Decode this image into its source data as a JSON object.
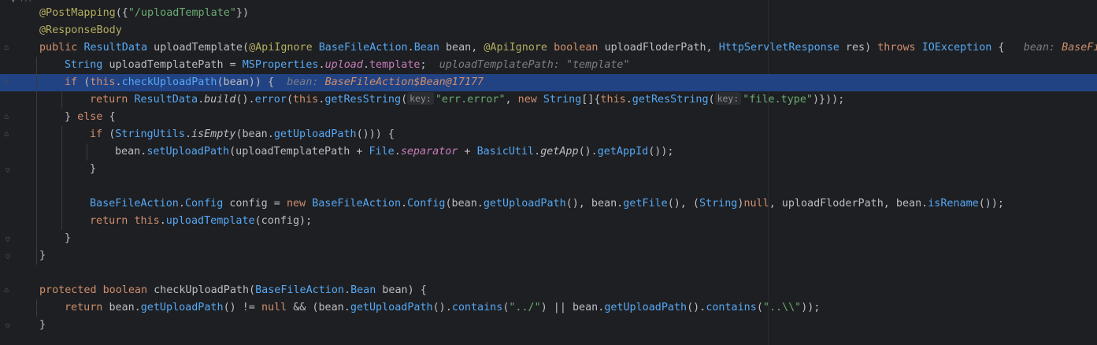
{
  "editor": {
    "lines": [
      {
        "indent": 1,
        "segments": [
          {
            "cls": "ann",
            "text": "@PostMapping"
          },
          {
            "cls": "plain",
            "text": "({"
          },
          {
            "cls": "str",
            "text": "\"/uploadTemplate\""
          },
          {
            "cls": "plain",
            "text": "})"
          }
        ]
      },
      {
        "indent": 1,
        "segments": [
          {
            "cls": "ann",
            "text": "@ResponseBody"
          }
        ]
      },
      {
        "indent": 1,
        "segments": [
          {
            "cls": "kw",
            "text": "public "
          },
          {
            "cls": "type",
            "text": "ResultData "
          },
          {
            "cls": "plain",
            "text": "uploadTemplate("
          },
          {
            "cls": "ann",
            "text": "@ApiIgnore "
          },
          {
            "cls": "type",
            "text": "BaseFileAction"
          },
          {
            "cls": "plain",
            "text": "."
          },
          {
            "cls": "type",
            "text": "Bean"
          },
          {
            "cls": "plain",
            "text": " bean, "
          },
          {
            "cls": "ann",
            "text": "@ApiIgnore "
          },
          {
            "cls": "kw",
            "text": "boolean "
          },
          {
            "cls": "plain",
            "text": "uploadFloderPath, "
          },
          {
            "cls": "type",
            "text": "HttpServletResponse"
          },
          {
            "cls": "plain",
            "text": " res) "
          },
          {
            "cls": "kw",
            "text": "throws "
          },
          {
            "cls": "type",
            "text": "IOException"
          },
          {
            "cls": "plain",
            "text": " {   "
          },
          {
            "cls": "hint",
            "text": "bean: "
          },
          {
            "cls": "hint-val",
            "text": "BaseFile"
          }
        ]
      },
      {
        "indent": 2,
        "segments": [
          {
            "cls": "type",
            "text": "String "
          },
          {
            "cls": "plain",
            "text": "uploadTemplatePath = "
          },
          {
            "cls": "type",
            "text": "MSProperties"
          },
          {
            "cls": "plain",
            "text": "."
          },
          {
            "cls": "sfield",
            "text": "upload"
          },
          {
            "cls": "plain",
            "text": "."
          },
          {
            "cls": "field",
            "text": "template"
          },
          {
            "cls": "plain",
            "text": ";  "
          },
          {
            "cls": "hint",
            "text": "uploadTemplatePath: \"template\""
          }
        ]
      },
      {
        "indent": 2,
        "highlight": true,
        "segments": [
          {
            "cls": "kw",
            "text": "if "
          },
          {
            "cls": "plain",
            "text": "("
          },
          {
            "cls": "kw",
            "text": "this"
          },
          {
            "cls": "plain",
            "text": "."
          },
          {
            "cls": "mcall",
            "text": "checkUploadPath"
          },
          {
            "cls": "plain",
            "text": "(bean)) {  "
          },
          {
            "cls": "hint",
            "text": "bean: "
          },
          {
            "cls": "hint-val",
            "text": "BaseFileAction$Bean@17177"
          }
        ]
      },
      {
        "indent": 3,
        "segments": [
          {
            "cls": "kw",
            "text": "return "
          },
          {
            "cls": "type",
            "text": "ResultData"
          },
          {
            "cls": "plain",
            "text": "."
          },
          {
            "cls": "static-call",
            "text": "build"
          },
          {
            "cls": "plain",
            "text": "()."
          },
          {
            "cls": "mcall",
            "text": "error"
          },
          {
            "cls": "plain",
            "text": "("
          },
          {
            "cls": "kw",
            "text": "this"
          },
          {
            "cls": "plain",
            "text": "."
          },
          {
            "cls": "mcall",
            "text": "getResString"
          },
          {
            "cls": "plain",
            "text": "("
          },
          {
            "cls": "inlay",
            "text": "key:"
          },
          {
            "cls": "str",
            "text": "\"err.error\""
          },
          {
            "cls": "plain",
            "text": ", "
          },
          {
            "cls": "kw",
            "text": "new "
          },
          {
            "cls": "type",
            "text": "String"
          },
          {
            "cls": "plain",
            "text": "[]{"
          },
          {
            "cls": "kw",
            "text": "this"
          },
          {
            "cls": "plain",
            "text": "."
          },
          {
            "cls": "mcall",
            "text": "getResString"
          },
          {
            "cls": "plain",
            "text": "("
          },
          {
            "cls": "inlay",
            "text": "key:"
          },
          {
            "cls": "str",
            "text": "\"file.type\""
          },
          {
            "cls": "plain",
            "text": ")}));"
          }
        ]
      },
      {
        "indent": 2,
        "segments": [
          {
            "cls": "plain",
            "text": "} "
          },
          {
            "cls": "kw",
            "text": "else "
          },
          {
            "cls": "plain",
            "text": "{"
          }
        ]
      },
      {
        "indent": 3,
        "segments": [
          {
            "cls": "kw",
            "text": "if "
          },
          {
            "cls": "plain",
            "text": "("
          },
          {
            "cls": "type",
            "text": "StringUtils"
          },
          {
            "cls": "plain",
            "text": "."
          },
          {
            "cls": "static-call",
            "text": "isEmpty"
          },
          {
            "cls": "plain",
            "text": "(bean."
          },
          {
            "cls": "mcall",
            "text": "getUploadPath"
          },
          {
            "cls": "plain",
            "text": "())) {"
          }
        ]
      },
      {
        "indent": 4,
        "segments": [
          {
            "cls": "plain",
            "text": "bean."
          },
          {
            "cls": "mcall",
            "text": "setUploadPath"
          },
          {
            "cls": "plain",
            "text": "(uploadTemplatePath + "
          },
          {
            "cls": "type",
            "text": "File"
          },
          {
            "cls": "plain",
            "text": "."
          },
          {
            "cls": "sfield",
            "text": "separator"
          },
          {
            "cls": "plain",
            "text": " + "
          },
          {
            "cls": "type",
            "text": "BasicUtil"
          },
          {
            "cls": "plain",
            "text": "."
          },
          {
            "cls": "static-call",
            "text": "getApp"
          },
          {
            "cls": "plain",
            "text": "()."
          },
          {
            "cls": "mcall",
            "text": "getAppId"
          },
          {
            "cls": "plain",
            "text": "());"
          }
        ]
      },
      {
        "indent": 3,
        "segments": [
          {
            "cls": "plain",
            "text": "}"
          }
        ]
      },
      {
        "indent": 0,
        "segments": []
      },
      {
        "indent": 3,
        "segments": [
          {
            "cls": "type",
            "text": "BaseFileAction"
          },
          {
            "cls": "plain",
            "text": "."
          },
          {
            "cls": "type",
            "text": "Config"
          },
          {
            "cls": "plain",
            "text": " config = "
          },
          {
            "cls": "kw",
            "text": "new "
          },
          {
            "cls": "type",
            "text": "BaseFileAction"
          },
          {
            "cls": "plain",
            "text": "."
          },
          {
            "cls": "type",
            "text": "Config"
          },
          {
            "cls": "plain",
            "text": "(bean."
          },
          {
            "cls": "mcall",
            "text": "getUploadPath"
          },
          {
            "cls": "plain",
            "text": "(), bean."
          },
          {
            "cls": "mcall",
            "text": "getFile"
          },
          {
            "cls": "plain",
            "text": "(), ("
          },
          {
            "cls": "type",
            "text": "String"
          },
          {
            "cls": "plain",
            "text": ")"
          },
          {
            "cls": "kw",
            "text": "null"
          },
          {
            "cls": "plain",
            "text": ", uploadFloderPath, bean."
          },
          {
            "cls": "mcall",
            "text": "isRename"
          },
          {
            "cls": "plain",
            "text": "());"
          }
        ]
      },
      {
        "indent": 3,
        "segments": [
          {
            "cls": "kw",
            "text": "return "
          },
          {
            "cls": "kw",
            "text": "this"
          },
          {
            "cls": "plain",
            "text": "."
          },
          {
            "cls": "mcall",
            "text": "uploadTemplate"
          },
          {
            "cls": "plain",
            "text": "(config);"
          }
        ]
      },
      {
        "indent": 2,
        "segments": [
          {
            "cls": "plain",
            "text": "}"
          }
        ]
      },
      {
        "indent": 1,
        "segments": [
          {
            "cls": "plain",
            "text": "}"
          }
        ]
      },
      {
        "indent": 0,
        "segments": []
      },
      {
        "indent": 1,
        "segments": [
          {
            "cls": "kw",
            "text": "protected "
          },
          {
            "cls": "kw",
            "text": "boolean "
          },
          {
            "cls": "plain",
            "text": "checkUploadPath("
          },
          {
            "cls": "type",
            "text": "BaseFileAction"
          },
          {
            "cls": "plain",
            "text": "."
          },
          {
            "cls": "type",
            "text": "Bean"
          },
          {
            "cls": "plain",
            "text": " bean) {"
          }
        ]
      },
      {
        "indent": 2,
        "segments": [
          {
            "cls": "kw",
            "text": "return "
          },
          {
            "cls": "plain",
            "text": "bean."
          },
          {
            "cls": "mcall",
            "text": "getUploadPath"
          },
          {
            "cls": "plain",
            "text": "() != "
          },
          {
            "cls": "kw",
            "text": "null"
          },
          {
            "cls": "plain",
            "text": " && (bean."
          },
          {
            "cls": "mcall",
            "text": "getUploadPath"
          },
          {
            "cls": "plain",
            "text": "()."
          },
          {
            "cls": "mcall",
            "text": "contains"
          },
          {
            "cls": "plain",
            "text": "("
          },
          {
            "cls": "str",
            "text": "\"../\""
          },
          {
            "cls": "plain",
            "text": ") || bean."
          },
          {
            "cls": "mcall",
            "text": "getUploadPath"
          },
          {
            "cls": "plain",
            "text": "()."
          },
          {
            "cls": "mcall",
            "text": "contains"
          },
          {
            "cls": "plain",
            "text": "("
          },
          {
            "cls": "str",
            "text": "\"..\\\\\""
          },
          {
            "cls": "plain",
            "text": "));"
          }
        ]
      },
      {
        "indent": 1,
        "segments": [
          {
            "cls": "plain",
            "text": "}"
          }
        ]
      }
    ]
  }
}
